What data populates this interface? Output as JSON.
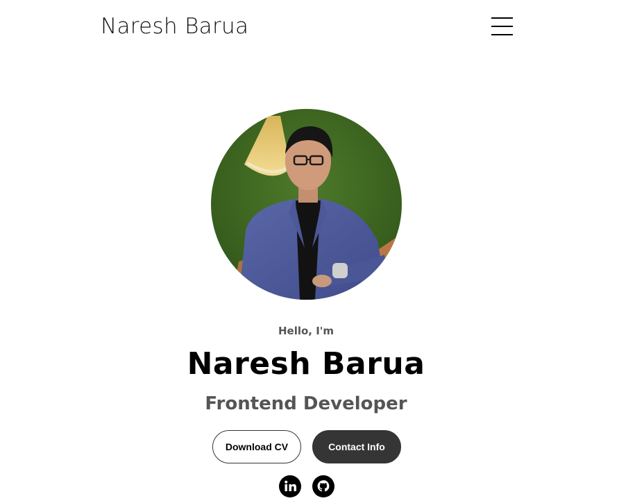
{
  "nav": {
    "logo": "Naresh Barua",
    "menu_icon": "hamburger-menu-icon"
  },
  "hero": {
    "avatar_icon": "profile-photo",
    "greeting": "Hello, I'm",
    "name": "Naresh Barua",
    "role": "Frontend Developer",
    "buttons": {
      "download_cv": "Download CV",
      "contact_info": "Contact Info"
    },
    "socials": [
      {
        "icon": "linkedin-icon"
      },
      {
        "icon": "github-icon"
      }
    ]
  },
  "colors": {
    "text_primary": "#000000",
    "text_secondary": "#555555",
    "button_dark": "#353535",
    "background": "#ffffff"
  }
}
